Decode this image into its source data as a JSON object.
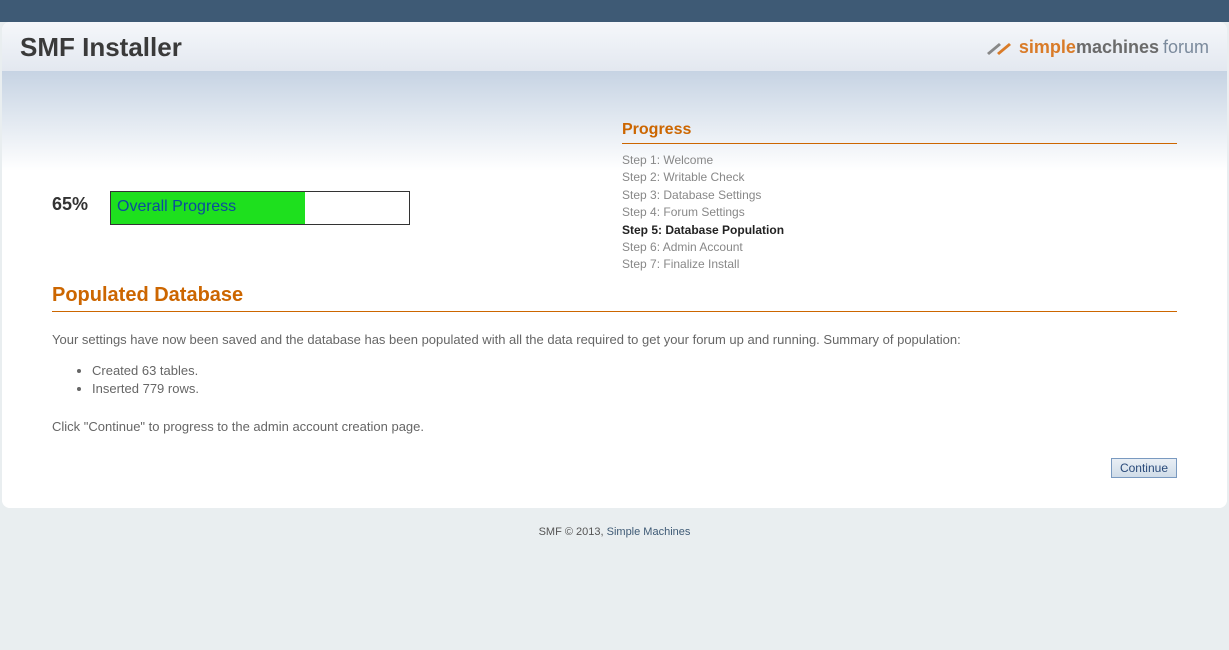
{
  "header": {
    "title": "SMF Installer",
    "logo_simple": "simple",
    "logo_machines": "machines",
    "logo_forum": "forum"
  },
  "progress": {
    "percent_label": "65%",
    "percent_value": 65,
    "bar_label": "Overall Progress",
    "heading": "Progress",
    "steps": [
      "Step 1: Welcome",
      "Step 2: Writable Check",
      "Step 3: Database Settings",
      "Step 4: Forum Settings",
      "Step 5: Database Population",
      "Step 6: Admin Account",
      "Step 7: Finalize Install"
    ],
    "current_index": 4
  },
  "main": {
    "heading": "Populated Database",
    "intro": "Your settings have now been saved and the database has been populated with all the data required to get your forum up and running. Summary of population:",
    "bullets": [
      "Created 63 tables.",
      "Inserted 779 rows."
    ],
    "outro": "Click \"Continue\" to progress to the admin account creation page.",
    "continue_label": "Continue"
  },
  "footer": {
    "copyright": "SMF © 2013, ",
    "link": "Simple Machines"
  }
}
